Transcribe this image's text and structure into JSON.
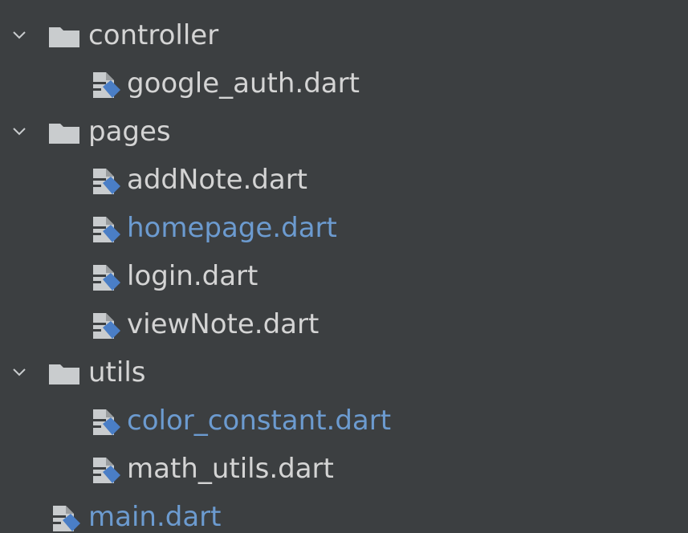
{
  "colors": {
    "background": "#3c3f41",
    "text": "#d4d4d4",
    "modified_text": "#6c9bd0",
    "folder": "#c9ccce",
    "dart_blue": "#4a7ec6"
  },
  "tree": {
    "folder_controller": {
      "label": "controller",
      "icon": "folder-icon",
      "expanded": true
    },
    "file_google_auth": {
      "label": "google_auth.dart",
      "icon": "dart-file-icon"
    },
    "folder_pages": {
      "label": "pages",
      "icon": "folder-icon",
      "expanded": true
    },
    "file_addnote": {
      "label": "addNote.dart",
      "icon": "dart-file-icon"
    },
    "file_homepage": {
      "label": "homepage.dart",
      "icon": "dart-file-icon",
      "modified": true
    },
    "file_login": {
      "label": "login.dart",
      "icon": "dart-file-icon"
    },
    "file_viewnote": {
      "label": "viewNote.dart",
      "icon": "dart-file-icon"
    },
    "folder_utils": {
      "label": "utils",
      "icon": "folder-icon",
      "expanded": true
    },
    "file_color_constant": {
      "label": "color_constant.dart",
      "icon": "dart-file-icon",
      "modified": true
    },
    "file_math_utils": {
      "label": "math_utils.dart",
      "icon": "dart-file-icon"
    },
    "file_main": {
      "label": "main.dart",
      "icon": "dart-file-icon",
      "modified": true
    }
  }
}
